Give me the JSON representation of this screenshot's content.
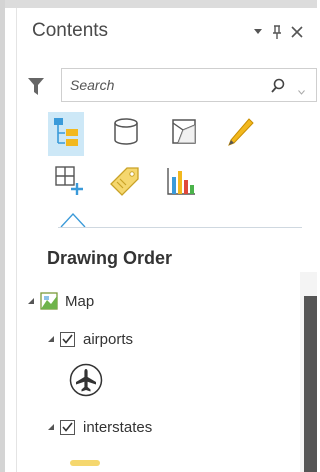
{
  "panel": {
    "title": "Contents",
    "controls": [
      "dropdown-icon",
      "pin-icon",
      "close-icon"
    ]
  },
  "search": {
    "placeholder": "Search",
    "value": ""
  },
  "toolbar": {
    "row1": [
      "list-by-drawing-order-icon",
      "list-by-data-source-icon",
      "list-by-selection-icon",
      "list-by-editing-icon"
    ],
    "row2": [
      "list-by-snapping-icon",
      "list-by-labeling-icon",
      "list-charts-icon"
    ],
    "selected": "list-by-drawing-order-icon"
  },
  "section": {
    "title": "Drawing Order"
  },
  "tree": {
    "map": {
      "label": "Map",
      "expanded": true
    },
    "layers": [
      {
        "label": "airports",
        "checked": true,
        "expanded": true,
        "symbol": "airplane-symbol-icon"
      },
      {
        "label": "interstates",
        "checked": true,
        "expanded": true,
        "symbol": "yellow-line-symbol-icon"
      }
    ]
  },
  "colors": {
    "selected_tool_bg": "#cde8f7",
    "accent_blue": "#3a9ad9",
    "pencil": "#f2b81e",
    "interstate_symbol": "#f5d76e"
  }
}
